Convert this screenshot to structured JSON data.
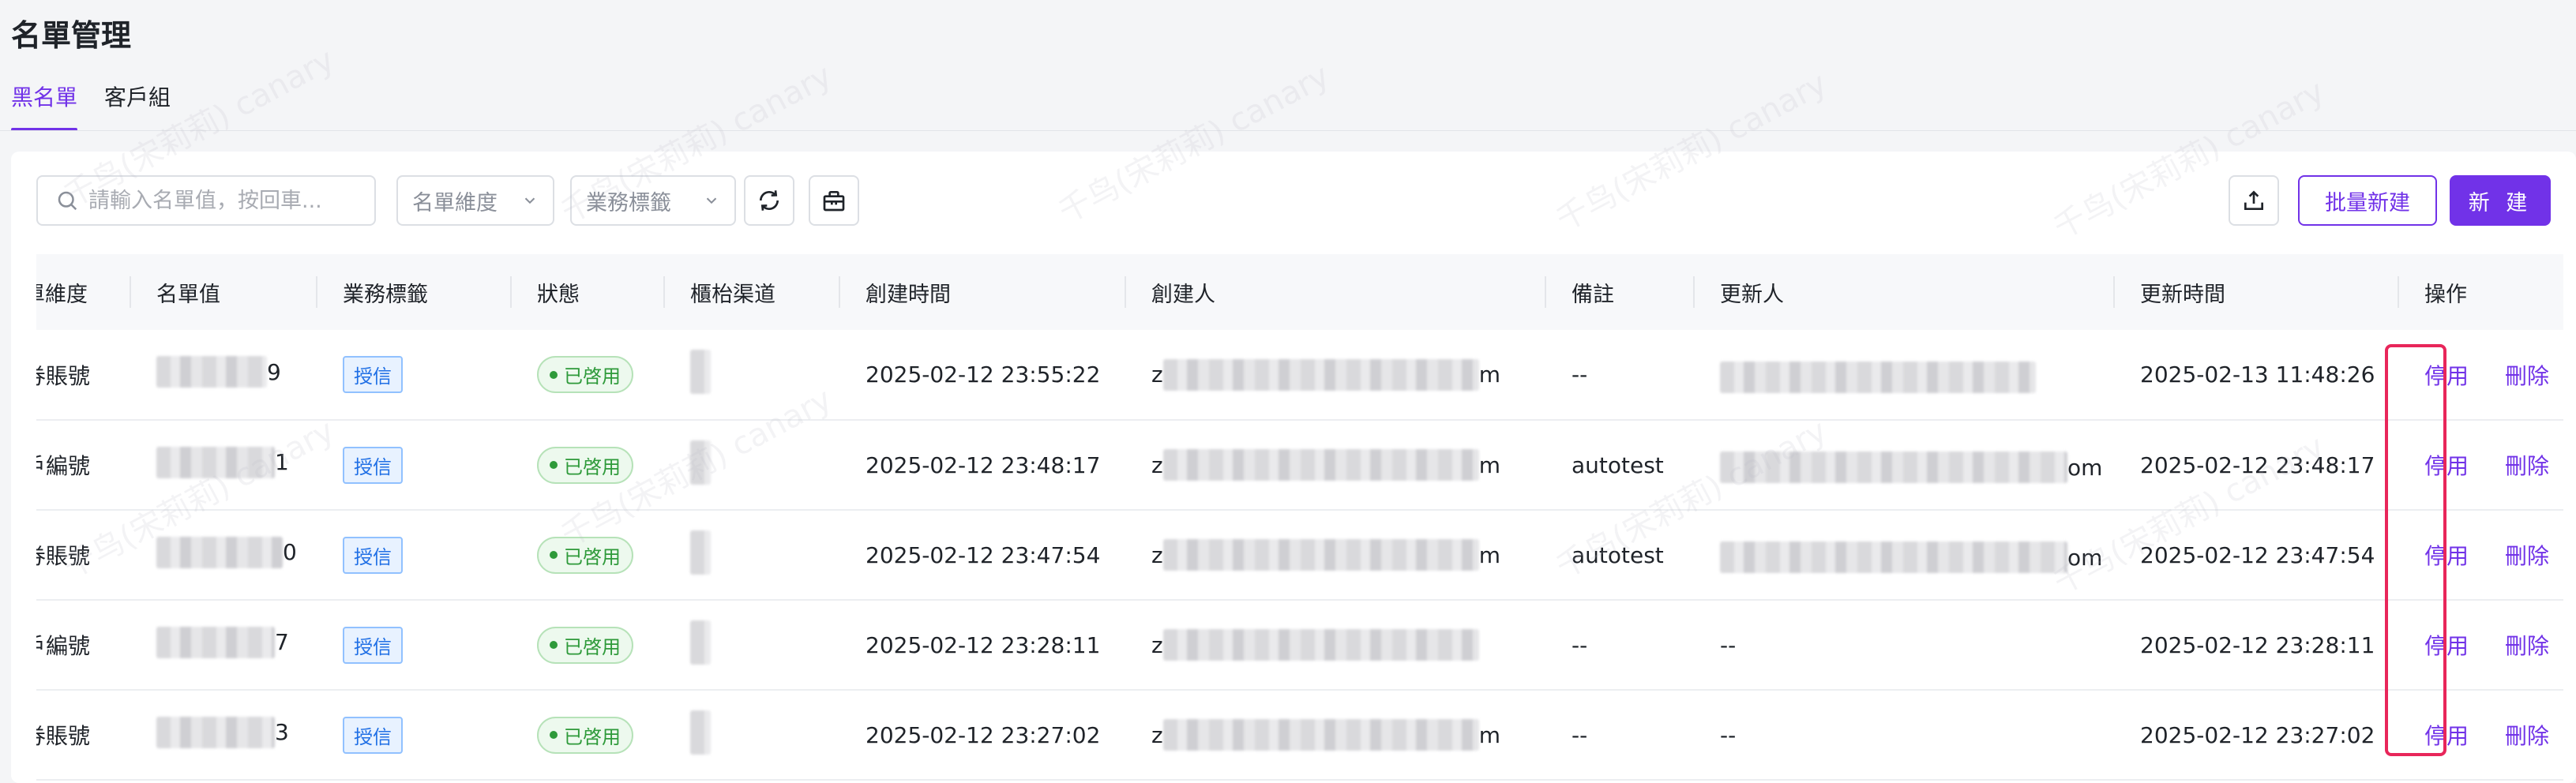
{
  "page": {
    "title": "名單管理"
  },
  "tabs": [
    {
      "label": "黑名單",
      "active": true
    },
    {
      "label": "客戶組",
      "active": false
    }
  ],
  "toolbar": {
    "search_placeholder": "請輸入名單值，按回車...",
    "dimension_select": "名單維度",
    "tag_select": "業務標籤",
    "batch_new_label": "批量新建",
    "new_label": "新 建",
    "icons": {
      "search": "search-icon",
      "chevron": "chevron-down-icon",
      "refresh": "refresh-icon",
      "box": "package-icon",
      "export": "export-icon"
    }
  },
  "table": {
    "columns": [
      "單維度",
      "名單值",
      "業務標籤",
      "狀態",
      "櫃枱渠道",
      "創建時間",
      "創建人",
      "備註",
      "更新人",
      "更新時間",
      "操作"
    ],
    "rows": [
      {
        "dim": "券賬號",
        "value_tail": "9",
        "tag": "授信",
        "status": "已啓用",
        "created": "2025-02-12 23:55:22",
        "creator_head": "z",
        "creator_tail": "m",
        "note": "--",
        "updater_head": "",
        "updater_tail": "",
        "updated": "2025-02-13 11:48:26",
        "op_disable": "停用",
        "op_delete": "刪除"
      },
      {
        "dim": "戶編號",
        "value_tail": "1",
        "tag": "授信",
        "status": "已啓用",
        "created": "2025-02-12 23:48:17",
        "creator_head": "z",
        "creator_tail": "m",
        "note": "autotest",
        "updater_head": "",
        "updater_tail": "om",
        "updated": "2025-02-12 23:48:17",
        "op_disable": "停用",
        "op_delete": "刪除"
      },
      {
        "dim": "券賬號",
        "value_tail": "0",
        "tag": "授信",
        "status": "已啓用",
        "created": "2025-02-12 23:47:54",
        "creator_head": "z",
        "creator_tail": "m",
        "note": "autotest",
        "updater_head": "",
        "updater_tail": "om",
        "updated": "2025-02-12 23:47:54",
        "op_disable": "停用",
        "op_delete": "刪除"
      },
      {
        "dim": "戶編號",
        "value_tail": "7",
        "tag": "授信",
        "status": "已啓用",
        "created": "2025-02-12 23:28:11",
        "creator_head": "z",
        "creator_tail": "",
        "note": "--",
        "updater_head": "--",
        "updater_tail": "",
        "updated": "2025-02-12 23:28:11",
        "op_disable": "停用",
        "op_delete": "刪除"
      },
      {
        "dim": "券賬號",
        "value_tail": "3",
        "tag": "授信",
        "status": "已啓用",
        "created": "2025-02-12 23:27:02",
        "creator_head": "z",
        "creator_tail": "m",
        "note": "--",
        "updater_head": "--",
        "updater_tail": "",
        "updated": "2025-02-12 23:27:02",
        "op_disable": "停用",
        "op_delete": "刪除"
      }
    ]
  },
  "colors": {
    "accent": "#7132e8",
    "highlight": "#e8265a",
    "status_green": "#2e9a3a",
    "tag_blue": "#1f6fe5"
  }
}
